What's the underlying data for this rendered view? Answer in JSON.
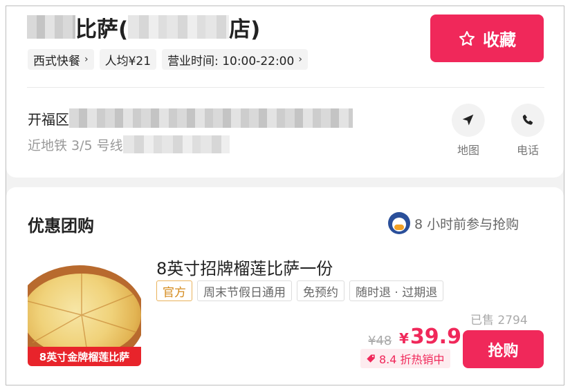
{
  "shop": {
    "name_mid": "比萨(",
    "name_end": "店)",
    "favorite_label": "收藏",
    "tags": [
      {
        "label": "西式快餐",
        "chevron": "›"
      },
      {
        "label": "人均¥21",
        "chevron": ""
      },
      {
        "label": "营业时间: 10:00-22:00",
        "chevron": "›"
      }
    ]
  },
  "address": {
    "district": "开福区",
    "near_metro": "近地铁 3/5 号线"
  },
  "actions": {
    "map_label": "地图",
    "phone_label": "电话"
  },
  "group_deals": {
    "section_title": "优惠团购",
    "recent_activity": "8 小时前参与抢购",
    "item": {
      "title": "8英寸招牌榴莲比萨一份",
      "image_banner": "8英寸金牌榴莲比萨",
      "tags": [
        "官方",
        "周末节假日通用",
        "免预约",
        "随时退 · 过期退"
      ],
      "sold": "已售 2794",
      "original_price": "¥48",
      "currency": "¥",
      "price": "39.9",
      "discount": "8.4 折热销中",
      "buy_label": "抢购"
    }
  },
  "colors": {
    "accent": "#f0285a",
    "official_tag": "#d48a1c",
    "muted_text": "#999999"
  }
}
